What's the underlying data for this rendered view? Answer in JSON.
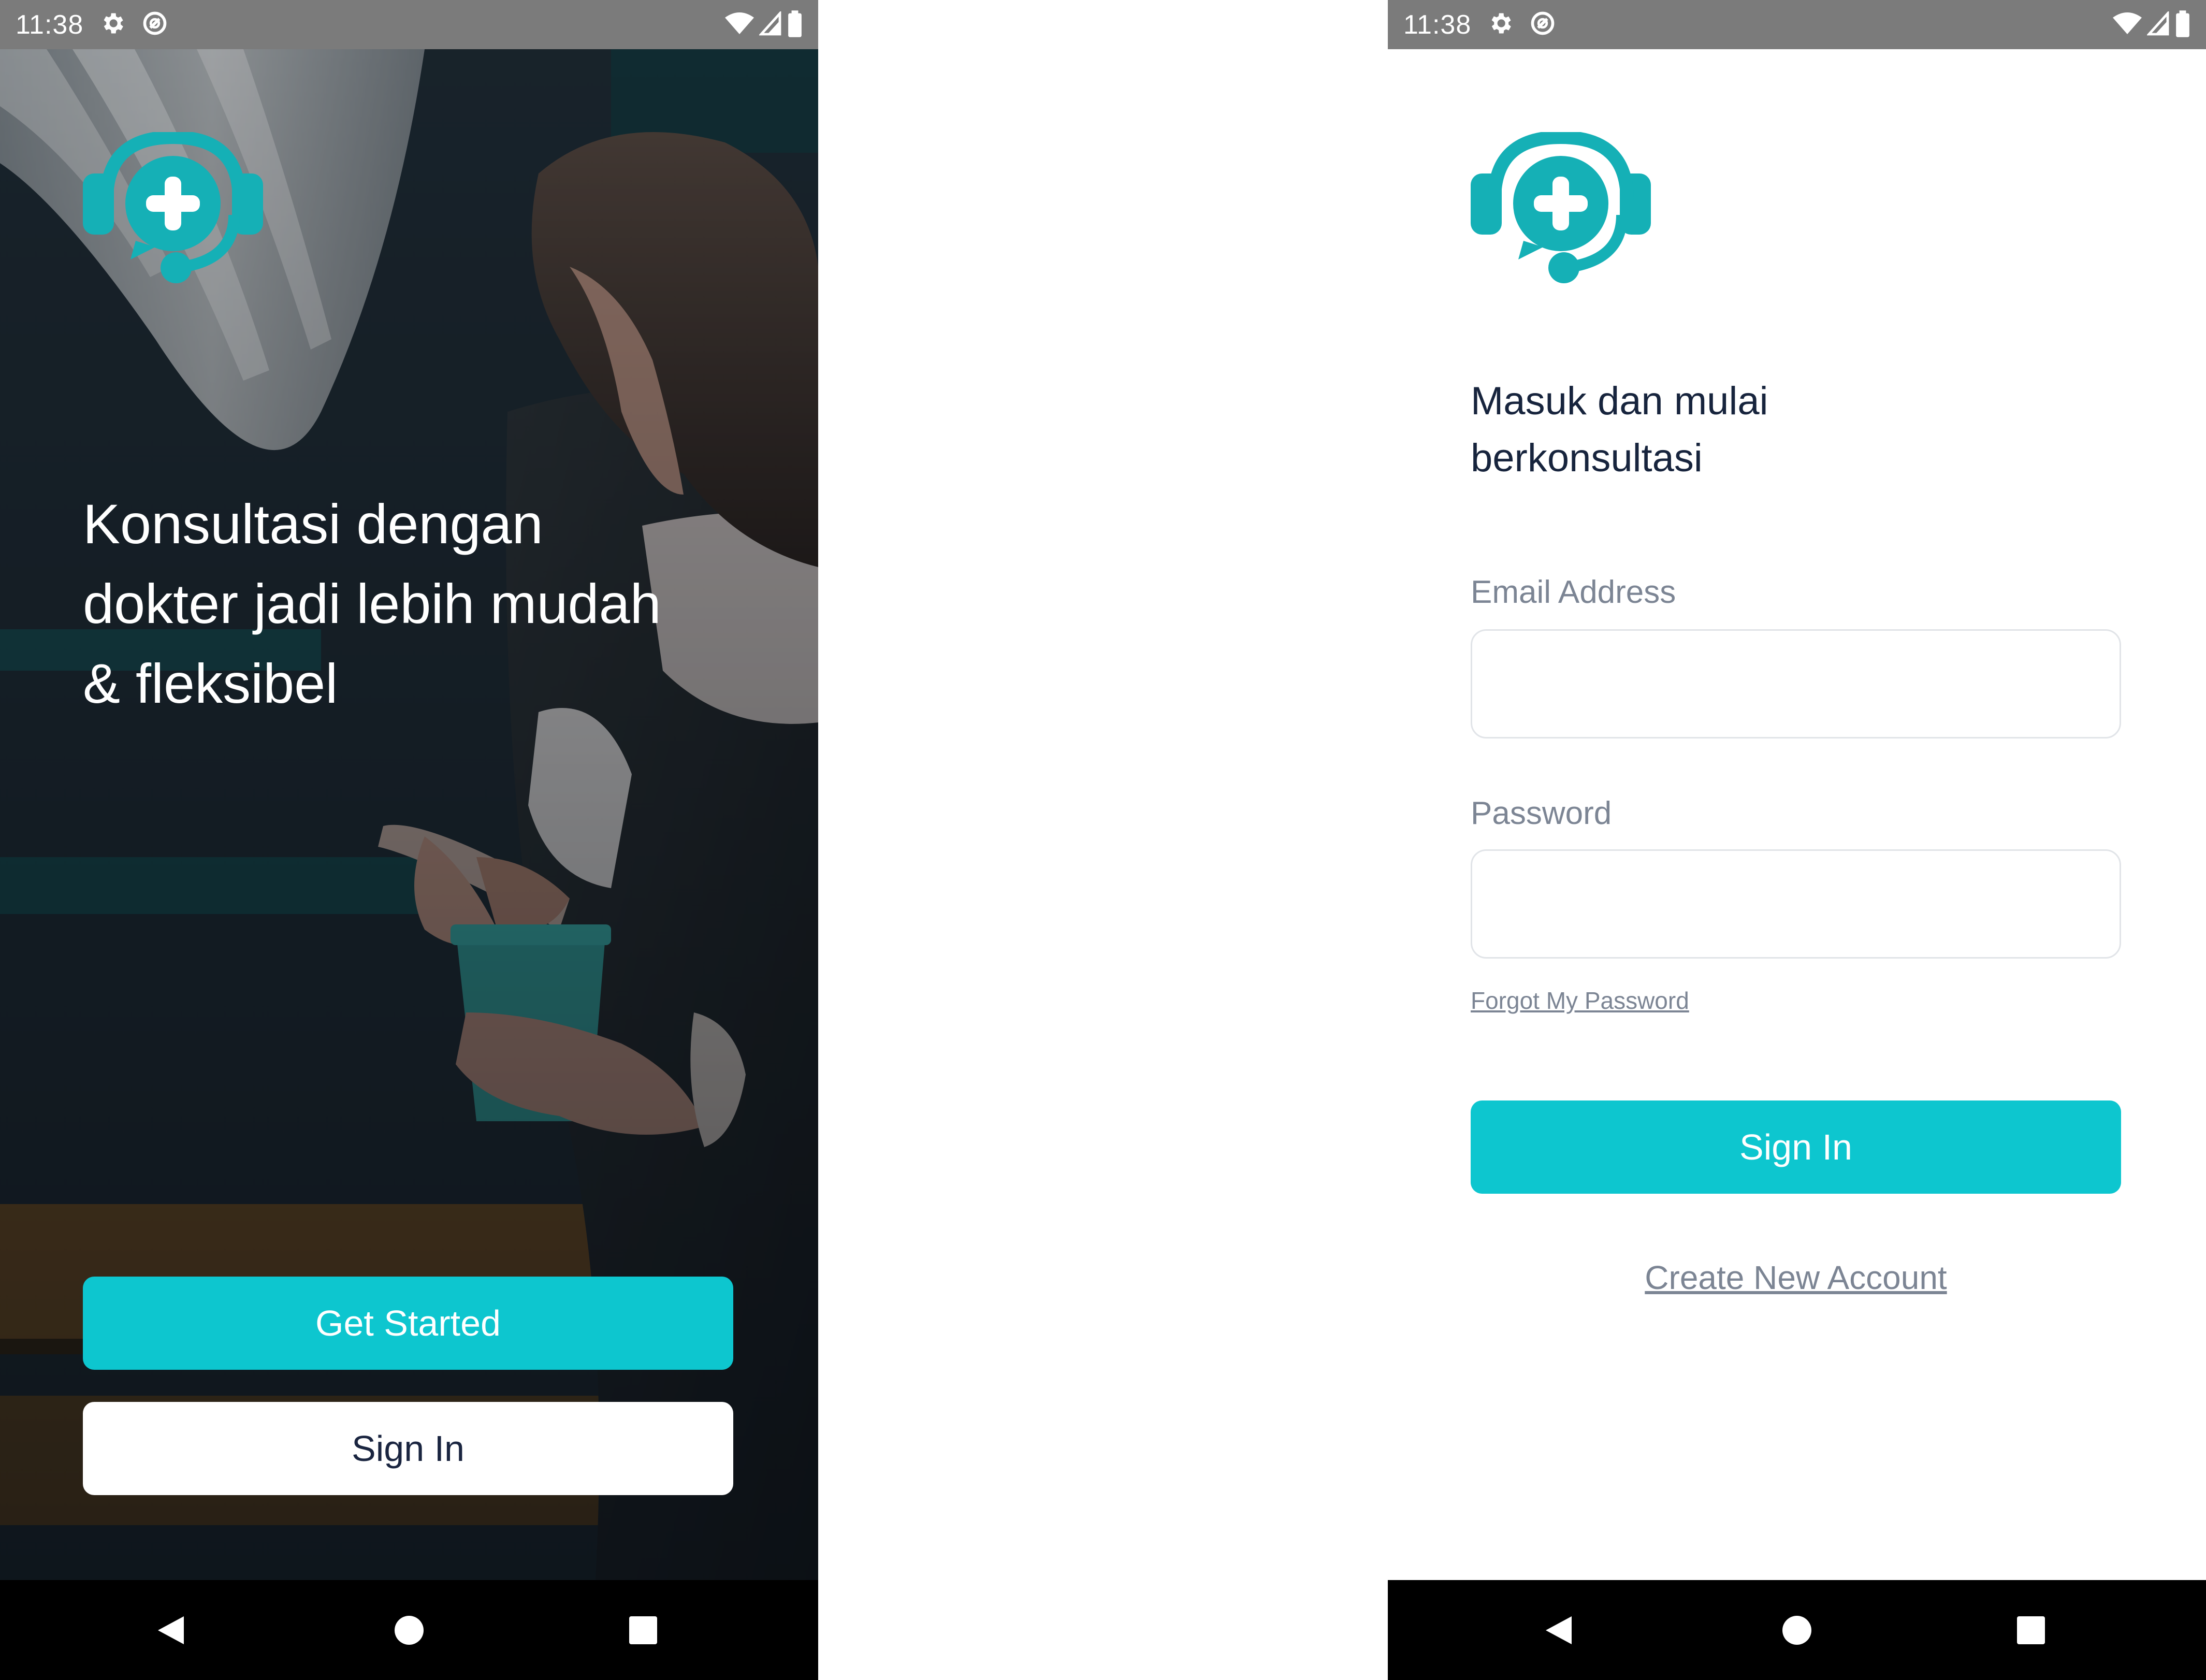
{
  "colors": {
    "accent": "#0dc6cf",
    "logo_teal": "#15b0b6",
    "title_navy": "#17243d",
    "muted_text": "#7c8594",
    "status_bar": "#7b7b7b",
    "nav_bar": "#000000"
  },
  "status_bar": {
    "time": "11:38",
    "icons": [
      "gear-icon",
      "sync-icon",
      "wifi-icon",
      "signal-icon",
      "battery-icon"
    ]
  },
  "welcome_screen": {
    "logo": "medical-chat-headset-logo",
    "headline": "Konsultasi dengan\ndokter jadi lebih mudah\n& fleksibel",
    "get_started_label": "Get Started",
    "sign_in_label": "Sign In"
  },
  "sign_in_screen": {
    "logo": "medical-chat-headset-logo",
    "headline": "Masuk dan mulai\nberkonsultasi",
    "email_label": "Email Address",
    "email_value": "",
    "password_label": "Password",
    "password_value": "",
    "forgot_password_label": "Forgot My Password",
    "sign_in_label": "Sign In",
    "create_account_label": "Create New Account"
  },
  "nav_bar": {
    "icons": [
      "back-icon",
      "home-icon",
      "recents-icon"
    ]
  }
}
